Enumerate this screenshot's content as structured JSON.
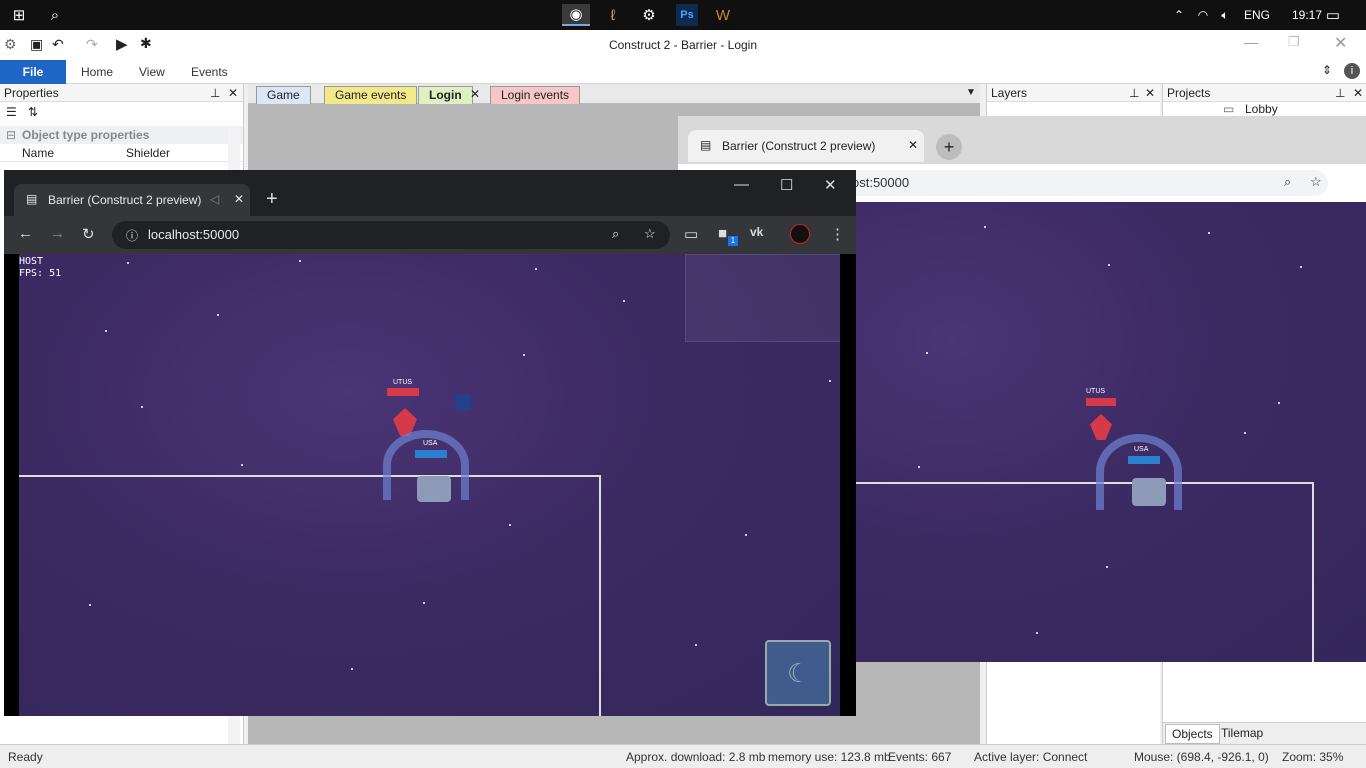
{
  "taskbar": {
    "lang": "ENG",
    "time": "19:17"
  },
  "window": {
    "title": "Construct 2 - Barrier - Login"
  },
  "ribbon": {
    "file": "File",
    "home": "Home",
    "view": "View",
    "events": "Events"
  },
  "properties": {
    "title": "Properties",
    "section": "Object type properties",
    "rows": [
      {
        "name": "Name",
        "value": "Shielder"
      }
    ]
  },
  "layout_tabs": [
    {
      "label": "Game"
    },
    {
      "label": "Game events"
    },
    {
      "label": "Login"
    },
    {
      "label": "Login events"
    }
  ],
  "layers": {
    "title": "Layers"
  },
  "projects": {
    "title": "Projects",
    "item": "Lobby",
    "tabs": [
      "Objects",
      "Tilemap"
    ]
  },
  "status": {
    "ready": "Ready",
    "download": "Approx. download: 2.8 mb",
    "memory": "memory use: 123.8 mb",
    "events": "Events: 667",
    "layer": "Active layer: Connect",
    "mouse": "Mouse: (698.4, -926.1, 0)",
    "zoom": "Zoom: 35%"
  },
  "browser_front": {
    "tab_title": "Barrier (Construct 2 preview)",
    "url": "localhost:50000",
    "hud_host": "HOST",
    "hud_fps": "FPS: 51",
    "player1": "UTUS",
    "player2": "USA",
    "ext_badge": "1"
  },
  "browser_back": {
    "tab_title": "Barrier (Construct 2 preview)",
    "url_partial": "ost:50000",
    "player1": "UTUS",
    "player2": "USA"
  },
  "colors": {
    "accent": "#1f65c5",
    "space": "#3c2a63",
    "red_bar": "#d63a4a",
    "blue_bar": "#2a7fd0"
  }
}
